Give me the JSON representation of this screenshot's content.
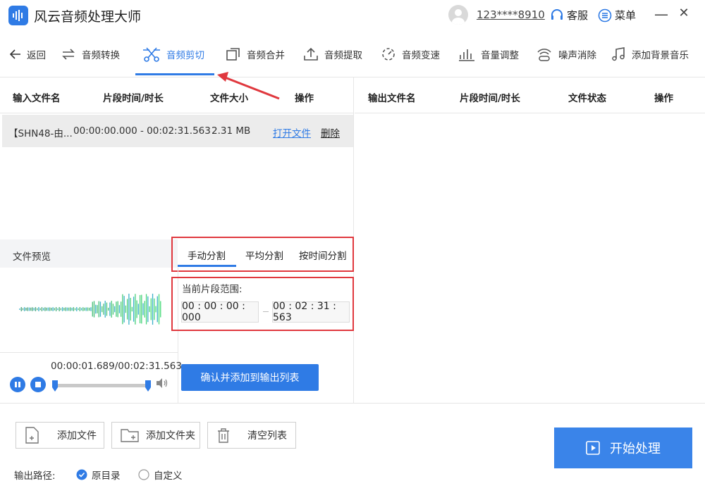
{
  "app": {
    "title": "风云音频处理大师",
    "accent": "#2f7be5"
  },
  "header": {
    "user_id": "123****8910",
    "service_label": "客服",
    "menu_label": "菜单",
    "minimize": "—",
    "close": "✕"
  },
  "toolbar": {
    "back_label": "返回",
    "tools": [
      {
        "label": "音频转换",
        "icon": "convert-icon"
      },
      {
        "label": "音频剪切",
        "icon": "scissors-icon",
        "active": true
      },
      {
        "label": "音频合并",
        "icon": "merge-icon"
      },
      {
        "label": "音频提取",
        "icon": "extract-icon"
      },
      {
        "label": "音频变速",
        "icon": "speed-icon"
      },
      {
        "label": "音量调整",
        "icon": "volume-bars-icon"
      },
      {
        "label": "噪声消除",
        "icon": "noise-icon"
      },
      {
        "label": "添加背景音乐",
        "icon": "music-note-icon"
      }
    ]
  },
  "input_table": {
    "headers": [
      "输入文件名",
      "片段时间/时长",
      "文件大小",
      "操作"
    ],
    "rows": [
      {
        "name": "【SHN48-由...",
        "time": "00:00:00.000 - 00:02:31.563",
        "size": "2.31 MB",
        "open": "打开文件",
        "delete": "删除"
      }
    ]
  },
  "output_table": {
    "headers": [
      "输出文件名",
      "片段时间/时长",
      "文件状态",
      "操作"
    ]
  },
  "preview": {
    "label": "文件预览",
    "time_display": "00:00:01.689/00:02:31.563",
    "progress": 0.011
  },
  "split": {
    "tabs": [
      "手动分割",
      "平均分割",
      "按时间分割"
    ],
    "active_tab": 0,
    "range_label": "当前片段范围:",
    "start": "00 : 00 : 00 : 000",
    "end": "00 : 02 : 31 : 563",
    "confirm": "确认并添加到输出列表"
  },
  "bottom": {
    "add_file": "添加文件",
    "add_folder": "添加文件夹",
    "clear_list": "清空列表",
    "start": "开始处理",
    "output_path_label": "输出路径:",
    "options": [
      {
        "label": "原目录",
        "checked": true
      },
      {
        "label": "自定义",
        "checked": false
      }
    ]
  }
}
